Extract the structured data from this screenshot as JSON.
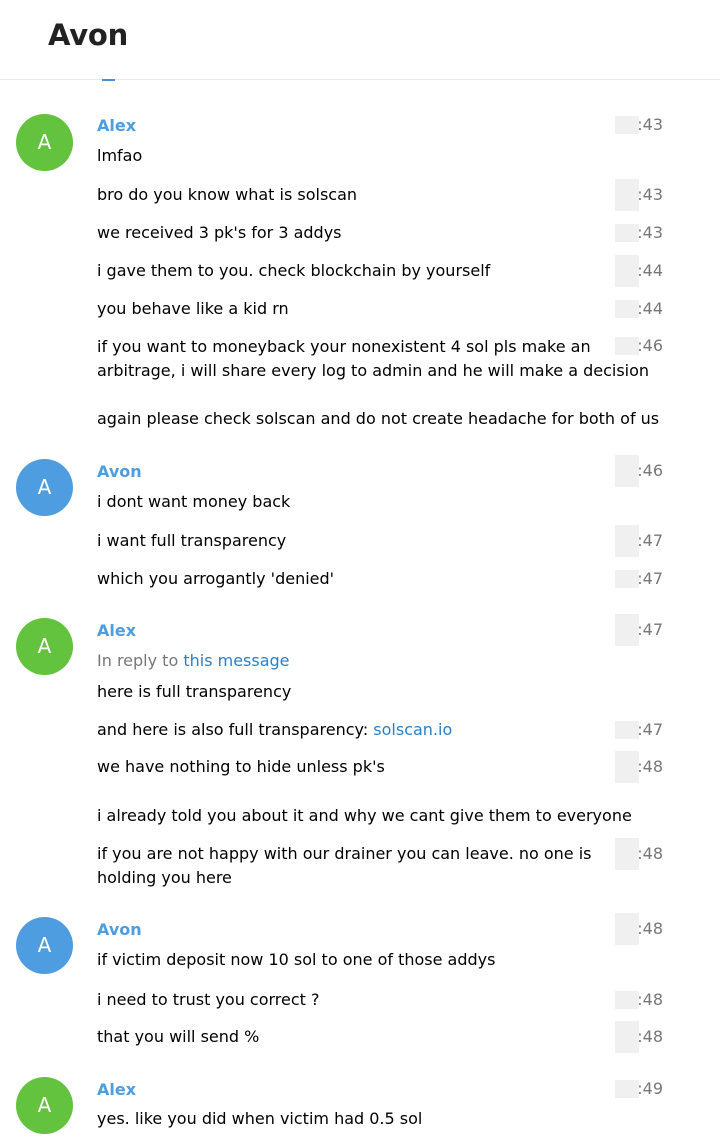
{
  "chat": {
    "title": "Avon"
  },
  "colors": {
    "alex": "#63c33f",
    "avon": "#4e9de0",
    "link": "#2a7fc7"
  },
  "messages": [
    {
      "text": "lmfao",
      "time": ":43"
    },
    {
      "text": "bro do you know what is solscan",
      "time": ":43"
    },
    {
      "text": "we received 3 pk's for 3 addys",
      "time": ":43"
    },
    {
      "text": "i gave them to you. check blockchain by yourself",
      "time": ":44"
    },
    {
      "text": "you behave like a kid rn",
      "time": ":44"
    },
    {
      "line1": "if you want to moneyback your nonexistent 4 sol pls make an",
      "line2": "arbitrage, i will share every log to admin and he will make a decision",
      "time": ":46"
    },
    {
      "text": "again please check solscan and do not create headache for both of us"
    },
    {
      "text": "i dont want money back",
      "time": ":46"
    },
    {
      "text": "i want full transparency",
      "time": ":47"
    },
    {
      "text": "which you arrogantly 'denied'",
      "time": ":47"
    },
    {
      "reply_prefix": "In reply to ",
      "reply_link": "this message",
      "text": "here is full transparency",
      "time": ":47"
    },
    {
      "text": "and here is also full transparency: ",
      "link": "solscan.io",
      "time": ":47"
    },
    {
      "text": "we have nothing to hide unless pk's",
      "time": ":48"
    },
    {
      "text": "i already told you about it and why we cant give them to everyone"
    },
    {
      "line1": "if you are not happy with our drainer you can leave. no one is",
      "line2": "holding you here",
      "time": ":48"
    },
    {
      "text": "if victim deposit now 10 sol to one of those addys",
      "time": ":48"
    },
    {
      "text": "i need to trust you correct ?",
      "time": ":48"
    },
    {
      "text": "that you will send %",
      "time": ":48"
    },
    {
      "text": "yes. like you did when victim had 0.5 sol",
      "time": ":49"
    }
  ],
  "senders": {
    "alex": {
      "name": "Alex",
      "initial": "A"
    },
    "avon": {
      "name": "Avon",
      "initial": "A"
    }
  }
}
